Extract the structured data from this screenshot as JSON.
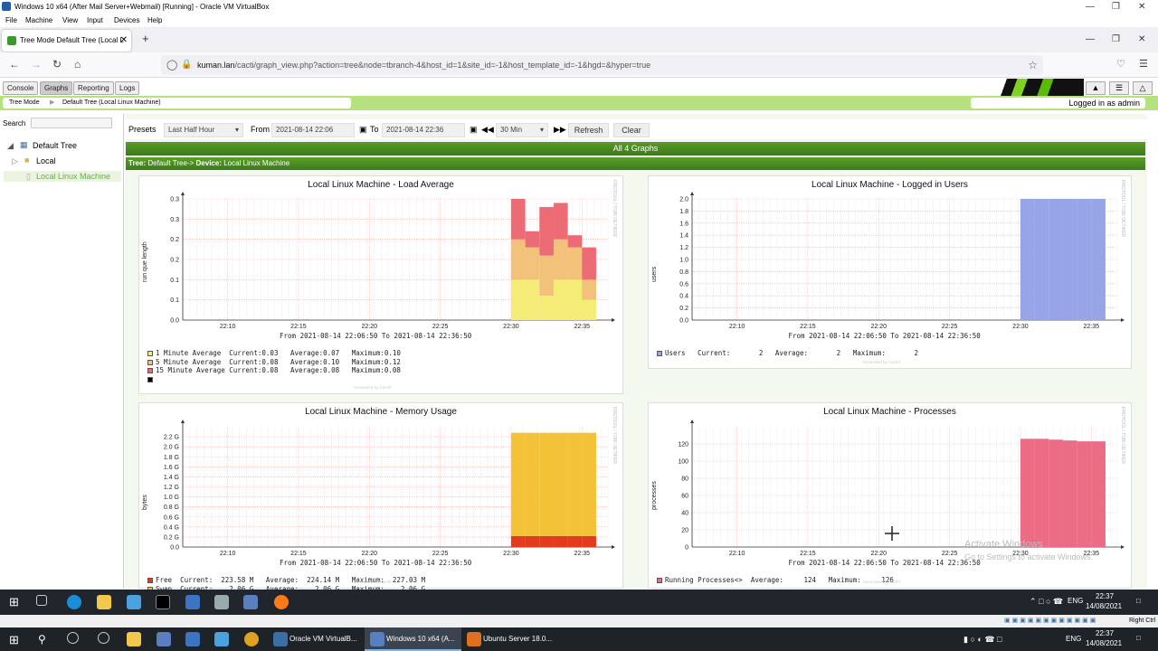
{
  "window": {
    "title": "Windows 10 x64 (After Mail Server+Webmail) [Running] - Oracle VM VirtualBox"
  },
  "vbox_menu": [
    "File",
    "Machine",
    "View",
    "Input",
    "Devices",
    "Help"
  ],
  "browser": {
    "tab_title": "Tree Mode Default Tree (Local L",
    "url_host": "kuman.lan",
    "url_path": "/cacti/graph_view.php?action=tree&node=tbranch-4&host_id=1&site_id=-1&host_template_id=-1&hgd=&hyper=true"
  },
  "cacti": {
    "tabs": [
      "Console",
      "Graphs",
      "Reporting",
      "Logs"
    ],
    "active_tab": "Graphs",
    "breadcrumb": [
      "Tree Mode",
      "Default Tree (Local Linux Machine)"
    ],
    "logged_in": "Logged in as admin",
    "search_label": "Search",
    "tree": {
      "root": "Default Tree",
      "site": "Local",
      "device": "Local Linux Machine"
    },
    "filter": {
      "presets_label": "Presets",
      "preset_value": "Last Half Hour",
      "from_label": "From",
      "from_value": "2021-08-14 22:06",
      "to_label": "To",
      "to_value": "2021-08-14 22:36",
      "timespan": "30 Min",
      "refresh": "Refresh",
      "clear": "Clear"
    },
    "all_graphs": "All 4 Graphs",
    "tree_line_label": "Tree:",
    "tree_line_tree": "Default Tree->",
    "tree_line_device_label": "Device:",
    "tree_line_device": "Local Linux Machine",
    "rrd_credit": "RRDTOOL / TOBI OETIKER",
    "generated_by": "Generated by Cacti®",
    "time_range_text": "From 2021-08-14 22:06:50 To 2021-08-14 22:36:50"
  },
  "chart_data": [
    {
      "type": "area",
      "title": "Local Linux Machine - Load Average",
      "ylabel": "run que length",
      "x_ticks": [
        "22:10",
        "22:15",
        "22:20",
        "22:25",
        "22:30",
        "22:35"
      ],
      "y_ticks": [
        "0.0",
        "0.1",
        "0.1",
        "0.2",
        "0.2",
        "0.3",
        "0.3"
      ],
      "ylim": [
        0,
        0.3
      ],
      "colors": [
        "#f5ec78",
        "#f2c27a",
        "#ec6b74"
      ],
      "series": [
        {
          "name": "1 Minute Average",
          "values": [
            0.1,
            0.1,
            0.06,
            0.1,
            0.1,
            0.05
          ]
        },
        {
          "name": "5 Minute Average",
          "values": [
            0.1,
            0.08,
            0.1,
            0.1,
            0.08,
            0.05
          ]
        },
        {
          "name": "15 Minute Average",
          "values": [
            0.1,
            0.04,
            0.12,
            0.09,
            0.03,
            0.08
          ]
        }
      ],
      "x": [
        "22:30",
        "22:31",
        "22:32",
        "22:33",
        "22:34",
        "22:35"
      ],
      "legend": [
        {
          "label": "1 Minute Average",
          "current": "Current:0.03",
          "average": "Average:0.07",
          "maximum": "Maximum:0.10",
          "color": "#f5ec78"
        },
        {
          "label": "5 Minute Average",
          "current": "Current:0.08",
          "average": "Average:0.10",
          "maximum": "Maximum:0.12",
          "color": "#f2c27a"
        },
        {
          "label": "15 Minute Average",
          "current": "Current:0.08",
          "average": "Average:0.08",
          "maximum": "Maximum:0.08",
          "color": "#ec6b74"
        }
      ]
    },
    {
      "type": "area",
      "title": "Local Linux Machine - Logged in Users",
      "ylabel": "users",
      "x_ticks": [
        "22:10",
        "22:15",
        "22:20",
        "22:25",
        "22:30",
        "22:35"
      ],
      "y_ticks": [
        "0.0",
        "0.2",
        "0.4",
        "0.6",
        "0.8",
        "1.0",
        "1.2",
        "1.4",
        "1.6",
        "1.8",
        "2.0"
      ],
      "ylim": [
        0,
        2
      ],
      "colors": [
        "#95a5e8"
      ],
      "series": [
        {
          "name": "Users",
          "values": [
            2,
            2,
            2,
            2,
            2,
            2
          ]
        }
      ],
      "x": [
        "22:30",
        "22:31",
        "22:32",
        "22:33",
        "22:34",
        "22:35"
      ],
      "legend": [
        {
          "label": "Users",
          "current": "Current:       2",
          "average": "Average:       2",
          "maximum": "Maximum:       2",
          "color": "#95a5e8"
        }
      ]
    },
    {
      "type": "area",
      "title": "Local Linux Machine - Memory Usage",
      "ylabel": "bytes",
      "x_ticks": [
        "22:10",
        "22:15",
        "22:20",
        "22:25",
        "22:30",
        "22:35"
      ],
      "y_ticks": [
        "0.0",
        "0.2 G",
        "0.4 G",
        "0.6 G",
        "0.8 G",
        "1.0 G",
        "1.2 G",
        "1.4 G",
        "1.6 G",
        "1.8 G",
        "2.0 G",
        "2.2 G"
      ],
      "ylim": [
        0,
        2.4
      ],
      "colors": [
        "#e23b1e",
        "#f4c237"
      ],
      "series": [
        {
          "name": "Free",
          "values": [
            0.22,
            0.22,
            0.22,
            0.22,
            0.22,
            0.22
          ]
        },
        {
          "name": "Swap",
          "values": [
            2.06,
            2.06,
            2.06,
            2.06,
            2.06,
            2.06
          ]
        }
      ],
      "x": [
        "22:30",
        "22:31",
        "22:32",
        "22:33",
        "22:34",
        "22:35"
      ],
      "legend": [
        {
          "label": "Free",
          "current": "Current:  223.58 M",
          "average": "Average:  224.14 M",
          "maximum": "Maximum:  227.03 M",
          "color": "#e23b1e"
        },
        {
          "label": "Swap",
          "current": "Current:    2.06 G",
          "average": "Average:    2.06 G",
          "maximum": "Maximum:    2.06 G",
          "color": "#f4c237"
        }
      ]
    },
    {
      "type": "area",
      "title": "Local Linux Machine - Processes",
      "ylabel": "processes",
      "x_ticks": [
        "22:10",
        "22:15",
        "22:20",
        "22:25",
        "22:30",
        "22:35"
      ],
      "y_ticks": [
        "0",
        "20",
        "40",
        "60",
        "80",
        "100",
        "120"
      ],
      "ylim": [
        0,
        140
      ],
      "colors": [
        "#ec6b85"
      ],
      "series": [
        {
          "name": "Running Processes<>",
          "values": [
            126,
            126,
            125,
            124,
            123,
            123
          ]
        }
      ],
      "x": [
        "22:30",
        "22:31",
        "22:32",
        "22:33",
        "22:34",
        "22:35"
      ],
      "legend": [
        {
          "label": "Running Processes<>",
          "current": "",
          "average": "Average:     124",
          "maximum": "Maximum:     126",
          "color": "#ec6b85"
        }
      ]
    }
  ],
  "activate": {
    "line1": "Activate Windows",
    "line2": "Go to Settings to activate Windows."
  },
  "vm_taskbar": {
    "clock_time": "22:37",
    "clock_date": "14/08/2021",
    "lang": "ENG"
  },
  "vbox_status": {
    "host_key": "Right Ctrl"
  },
  "host_taskbar": {
    "items": [
      "Oracle VM VirtualB...",
      "Windows 10 x64 (A...",
      "Ubuntu Server 18.0..."
    ],
    "lang": "ENG",
    "clock_time": "22:37",
    "clock_date": "14/08/2021"
  }
}
